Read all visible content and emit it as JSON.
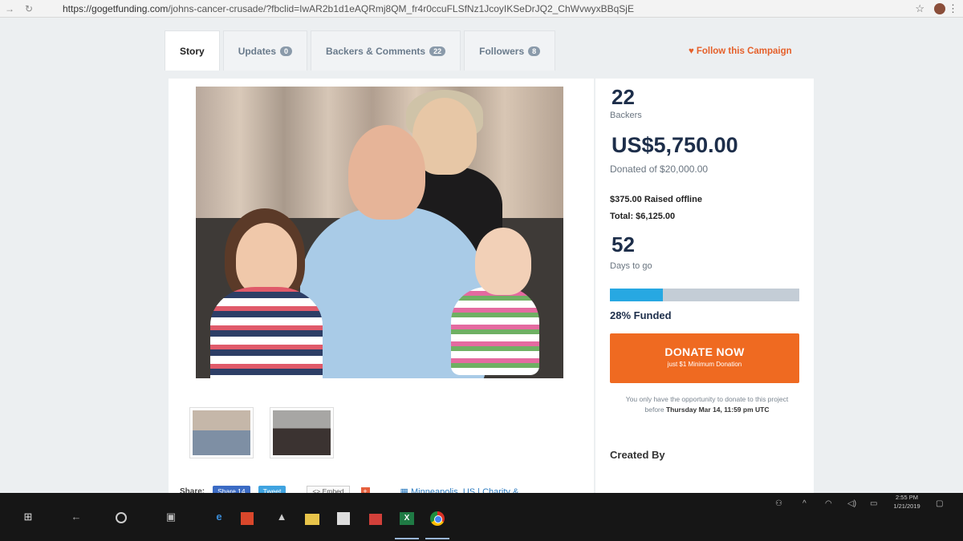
{
  "browser": {
    "url_domain": "https://gogetfunding.com",
    "url_path": "/johns-cancer-crusade/?fbclid=IwAR2b1d1eAQRmj8QM_fr4r0ccuFLSfNz1JcoyIKSeDrJQ2_ChWvwyxBBqSjE"
  },
  "tabs": [
    {
      "label": "Story",
      "count": ""
    },
    {
      "label": "Updates",
      "count": "0"
    },
    {
      "label": "Backers & Comments",
      "count": "22"
    },
    {
      "label": "Followers",
      "count": "8"
    }
  ],
  "follow": {
    "label": "Follow this Campaign"
  },
  "stats": {
    "backers_count": "22",
    "backers_label": "Backers",
    "raised": "US$5,750.00",
    "donated_of": "Donated of $20,000.00",
    "raised_offline": "$375.00 Raised offline",
    "total": "Total: $6,125.00",
    "days": "52",
    "days_label": "Days to go",
    "funded_percent": 28,
    "funded_label": "28% Funded"
  },
  "donate": {
    "label": "DONATE NOW",
    "sublabel": "just $1 Minimum Donation"
  },
  "note": {
    "prefix": "You only have the opportunity to donate to this project before",
    "deadline": "Thursday Mar 14, 11:59 pm UTC"
  },
  "created_by": "Created By",
  "share": {
    "label": "Share:",
    "facebook": "Share 14",
    "twitter": "Tweet",
    "embed": "<> Embed",
    "plus": "+",
    "location": "Minneapolis, US",
    "category": "Charity &"
  },
  "taskbar": {
    "time": "2:55 PM",
    "date": "1/21/2019"
  },
  "colors": {
    "accent_orange": "#ef6a21",
    "progress_blue": "#27a8e2",
    "navy": "#1d2e4a"
  }
}
